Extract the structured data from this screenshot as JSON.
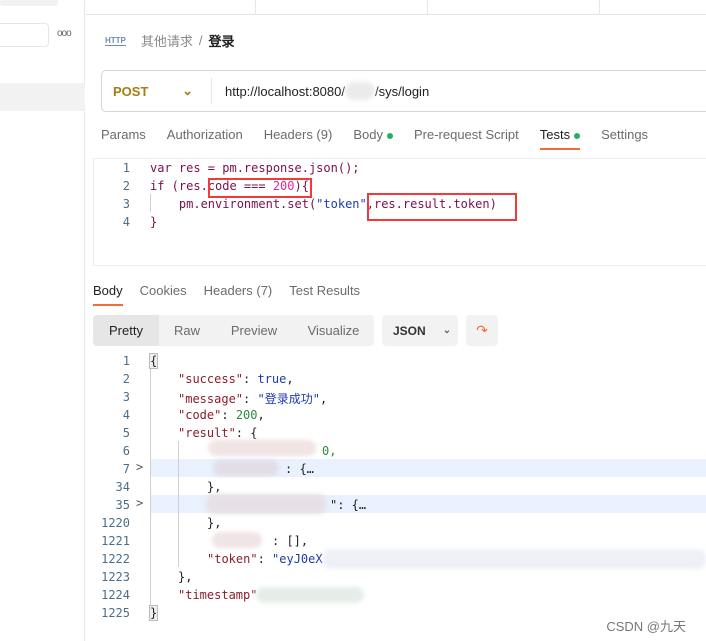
{
  "sidebar": {
    "more_icon": "ellipsis-icon"
  },
  "breadcrumb": {
    "icon": "http-icon",
    "icon_text": "HTTP",
    "parent": "其他请求",
    "separator": "/",
    "current": "登录"
  },
  "request": {
    "method": "POST",
    "url_prefix": "http://localhost:8080/",
    "url_suffix": "/sys/login"
  },
  "tabs": [
    {
      "label": "Params"
    },
    {
      "label": "Authorization"
    },
    {
      "label": "Headers (9)"
    },
    {
      "label": "Body",
      "dot": true
    },
    {
      "label": "Pre-request Script"
    },
    {
      "label": "Tests",
      "dot": true,
      "active": true
    },
    {
      "label": "Settings"
    }
  ],
  "tests_code": {
    "line_numbers": [
      "1",
      "2",
      "3",
      "4"
    ],
    "l1": "var res = pm.response.json();",
    "l2a": "if",
    "l2b": " (res.code === ",
    "l2c": "200",
    "l2d": "){",
    "l3a": "    pm.environment.set(",
    "l3b": "\"token\"",
    "l3c": ",res.result.token)",
    "l4": "}"
  },
  "response_tabs": [
    {
      "label": "Body",
      "active": true
    },
    {
      "label": "Cookies"
    },
    {
      "label": "Headers (7)"
    },
    {
      "label": "Test Results"
    }
  ],
  "view_modes": [
    {
      "label": "Pretty",
      "active": true
    },
    {
      "label": "Raw"
    },
    {
      "label": "Preview"
    },
    {
      "label": "Visualize"
    }
  ],
  "format": {
    "label": "JSON"
  },
  "wrap_icon": "wrap-lines-icon",
  "response_body": {
    "line_numbers": [
      "1",
      "2",
      "3",
      "4",
      "5",
      "6",
      "7",
      "34",
      "35",
      "1220",
      "1221",
      "1222",
      "1223",
      "1224",
      "1225"
    ],
    "open": "{",
    "success_key": "\"success\"",
    "success_val": "true",
    "message_key": "\"message\"",
    "message_val": "\"登录成功\"",
    "code_key": "\"code\"",
    "code_val": "200",
    "result_key": "\"result\"",
    "l6_val": "0,",
    "l7_tail": ": {…",
    "close_obj": "},",
    "l35_tail": "\": {…",
    "l1221_tail": ": [],",
    "token_key": "\"token\"",
    "token_val": "\"eyJ0eX",
    "timestamp_key": "\"timestamp\"",
    "close": "}"
  },
  "watermark": "CSDN @九天"
}
